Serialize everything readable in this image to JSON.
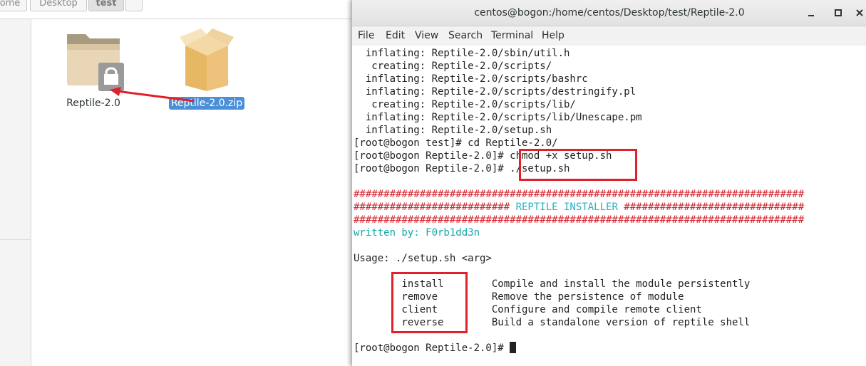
{
  "file_manager": {
    "breadcrumbs": [
      "ome",
      "Desktop",
      "test",
      ""
    ],
    "files": [
      {
        "name": "Reptile-2.0",
        "kind": "folder",
        "locked": true
      },
      {
        "name": "Reptile-2.0.zip",
        "kind": "archive",
        "selected": true
      }
    ]
  },
  "terminal": {
    "title": "centos@bogon:/home/centos/Desktop/test/Reptile-2.0",
    "menu": [
      "File",
      "Edit",
      "View",
      "Search",
      "Terminal",
      "Help"
    ],
    "lines": [
      "  inflating: Reptile-2.0/sbin/util.h",
      "   creating: Reptile-2.0/scripts/",
      "  inflating: Reptile-2.0/scripts/bashrc",
      "  inflating: Reptile-2.0/scripts/destringify.pl",
      "   creating: Reptile-2.0/scripts/lib/",
      "  inflating: Reptile-2.0/scripts/lib/Unescape.pm",
      "  inflating: Reptile-2.0/setup.sh",
      "[root@bogon test]# cd Reptile-2.0/",
      "[root@bogon Reptile-2.0]# chmod +x setup.sh",
      "[root@bogon Reptile-2.0]# ./setup.sh",
      "",
      "###########################################################################",
      "########################## REPTILE INSTALLER ##############################",
      "###########################################################################",
      "written by: F0rb1dd3n",
      "",
      "Usage: ./setup.sh <arg>",
      "",
      "        install        Compile and install the module persistently",
      "        remove         Remove the persistence of module",
      "        client         Configure and compile remote client",
      "        reverse        Build a standalone version of reptile shell",
      "",
      "[root@bogon Reptile-2.0]# "
    ],
    "banner": {
      "left": "########################## ",
      "middle": "REPTILE INSTALLER",
      "right": " ##############################"
    },
    "colors": {
      "banner": "#d3262f",
      "installer_title": "#2ab0c0",
      "author": "#16a7a7",
      "annotation": "#e0202a"
    }
  }
}
